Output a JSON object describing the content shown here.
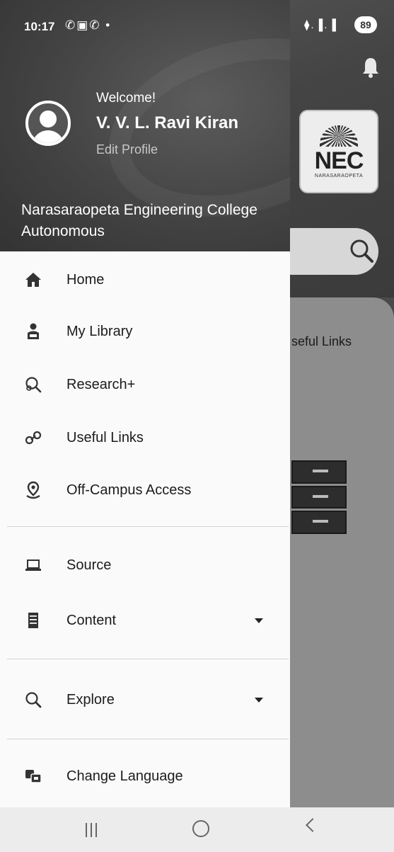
{
  "status_bar": {
    "time": "10:17",
    "left_icons": "✆▣✆ •",
    "right_icons": "⧫.▐.▐",
    "battery": "89"
  },
  "background": {
    "logo_text": "NEC",
    "logo_subtext": "NARASARAOPETA",
    "useful_links_partial": "seful Links"
  },
  "drawer": {
    "welcome": "Welcome!",
    "user_name": "V. V. L. Ravi Kiran",
    "edit_profile": "Edit Profile",
    "college_name": "Narasaraopeta Engineering College Autonomous",
    "menu": [
      {
        "label": "Home",
        "icon": "home-icon"
      },
      {
        "label": "My Library",
        "icon": "library-user-icon"
      },
      {
        "label": "Research+",
        "icon": "research-icon"
      },
      {
        "label": "Useful Links",
        "icon": "link-icon"
      },
      {
        "label": "Off-Campus Access",
        "icon": "location-pin-icon"
      },
      {
        "label": "Source",
        "icon": "laptop-icon"
      },
      {
        "label": "Content",
        "icon": "server-icon",
        "expandable": true
      },
      {
        "label": "Explore",
        "icon": "search-icon",
        "expandable": true
      },
      {
        "label": "Change Language",
        "icon": "translate-icon"
      }
    ]
  }
}
